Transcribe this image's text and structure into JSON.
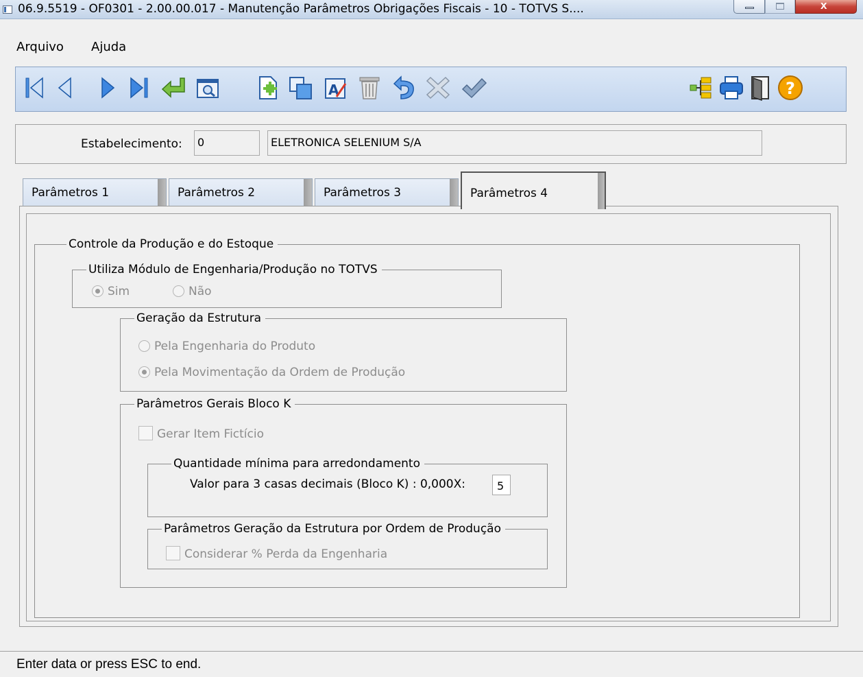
{
  "window": {
    "title": "06.9.5519 - OF0301 - 2.00.00.017 - Manutenção Parâmetros Obrigações Fiscais - 10 - TOTVS S....",
    "close_glyph": "x"
  },
  "menu": {
    "items": [
      "Arquivo",
      "Ajuda"
    ]
  },
  "toolbar": {
    "left_icons": [
      "first-record-icon",
      "previous-record-icon",
      "next-record-icon",
      "last-record-icon",
      "go-to-icon",
      "search-icon",
      "new-icon",
      "copy-icon",
      "edit-icon",
      "delete-icon",
      "undo-icon",
      "cancel-icon",
      "confirm-icon"
    ],
    "right_icons": [
      "tree-structure-icon",
      "print-icon",
      "exit-icon",
      "help-icon"
    ],
    "help_glyph": "?",
    "edit_glyph": "A",
    "accent_color": "#1f6fd1"
  },
  "estabelecimento": {
    "label": "Estabelecimento:",
    "code": "0",
    "name": "ELETRONICA SELENIUM S/A"
  },
  "tabs": [
    {
      "label": "Parâmetros 1"
    },
    {
      "label": "Parâmetros 2"
    },
    {
      "label": "Parâmetros 3"
    },
    {
      "label": "Parâmetros 4",
      "active": true
    }
  ],
  "controle": {
    "title": "Controle da Produção e do Estoque",
    "modulo": {
      "title": "Utiliza Módulo de Engenharia/Produção no TOTVS",
      "options": [
        "Sim",
        "Não"
      ],
      "selected": "Sim"
    },
    "geracao": {
      "title": "Geração da Estrutura",
      "options": [
        "Pela Engenharia do Produto",
        "Pela Movimentação da Ordem de Produção"
      ],
      "selected": "Pela Movimentação da Ordem de Produção"
    },
    "bloco_k": {
      "title": "Parâmetros Gerais Bloco K",
      "gerar_item_ficticio": "Gerar Item Fictício",
      "quantidade": {
        "title": "Quantidade mínima para arredondamento",
        "valor_label": "Valor para 3 casas decimais (Bloco K) : 0,000X:",
        "valor": "5"
      },
      "param_geracao": {
        "title": "Parâmetros Geração da Estrutura por Ordem de Produção",
        "considerar_perda": "Considerar % Perda da Engenharia"
      }
    }
  },
  "status": {
    "text": "Enter data or press ESC to end."
  }
}
